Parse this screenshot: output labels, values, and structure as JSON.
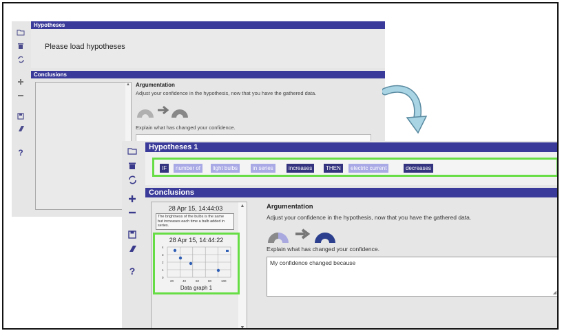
{
  "back_window": {
    "hypotheses_title": "Hypotheses",
    "hypotheses_message": "Please load hypotheses",
    "conclusions_title": "Conclusions",
    "argumentation_title": "Argumentation",
    "argumentation_text": "Adjust your confidence in the hypothesis, now that you have the gathered data.",
    "explain_label": "Explain what has changed your confidence."
  },
  "front_window": {
    "hypotheses_title": "Hypotheses 1",
    "hypothesis_tokens": [
      {
        "text": "IF",
        "style": "dark"
      },
      {
        "text": "number of",
        "style": "light"
      },
      {
        "text": "light bulbs",
        "style": "light"
      },
      {
        "text": "in series",
        "style": "light"
      },
      {
        "text": "increases",
        "style": "dark"
      },
      {
        "text": "THEN",
        "style": "dark"
      },
      {
        "text": "electric current",
        "style": "light"
      },
      {
        "text": "decreases",
        "style": "dark"
      }
    ],
    "conclusions_title": "Conclusions",
    "entry1_time": "28 Apr 15, 14:44:03",
    "entry1_note": "The brightness of the bulbs is the same but increases each time a bulb added in series.",
    "entry2_time": "28 Apr 15, 14:44:22",
    "entry2_caption": "Data graph 1",
    "mini_chart": {
      "y_ticks": [
        "4",
        "3",
        "2",
        "1",
        "0"
      ],
      "x_ticks": [
        "20",
        "40",
        "60",
        "80",
        "100"
      ]
    },
    "argumentation_title": "Argumentation",
    "argumentation_text": "Adjust your confidence in the hypothesis, now that you have the gathered data.",
    "explain_label": "Explain what has changed your confidence.",
    "explain_value": "My confidence changed because"
  },
  "toolbar_icons": [
    "folder-icon",
    "trash-icon",
    "refresh-icon",
    "plus-icon",
    "minus-icon",
    "save-icon",
    "eraser-icon",
    "help-icon"
  ],
  "help_label": "?",
  "colors": {
    "header_bar": "#3a3a9a",
    "token_dark": "#33337f",
    "token_light": "#a9a9e6",
    "highlight": "#66dd44",
    "curve_arrow": "#8fc4d8"
  }
}
